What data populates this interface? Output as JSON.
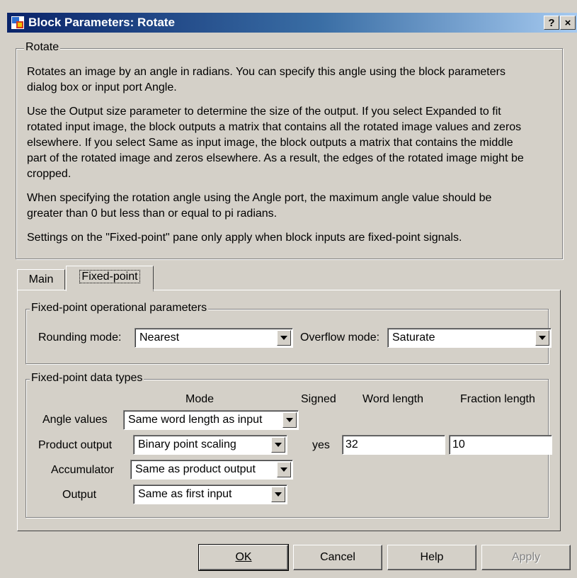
{
  "window": {
    "title": "Block Parameters: Rotate",
    "help_glyph": "?",
    "close_glyph": "×"
  },
  "description": {
    "group_title": "Rotate",
    "lines": [
      "Rotates an image by an angle in radians. You can specify this angle using the block parameters",
      "dialog box or input port Angle.",
      "Use the Output size parameter to determine the size of the output. If you select Expanded to fit",
      "rotated input image, the block outputs a matrix that contains all the rotated image values and zeros",
      "elsewhere. If you select Same as input image, the block outputs a matrix that contains the middle",
      "part of the rotated image and zeros elsewhere. As a result, the edges of the rotated image might be",
      "cropped.",
      "When specifying the rotation angle using the Angle port, the maximum angle value should be",
      "greater than 0 but less than or equal to pi radians.",
      "Settings on the \"Fixed-point\" pane only apply when block inputs are fixed-point signals."
    ]
  },
  "tabs": [
    {
      "label": "Main",
      "active": false
    },
    {
      "label": "Fixed-point",
      "active": true
    }
  ],
  "operational": {
    "group_title": "Fixed-point operational parameters",
    "rounding_label": "Rounding mode:",
    "rounding_value": "Nearest",
    "overflow_label": "Overflow mode:",
    "overflow_value": "Saturate"
  },
  "datatypes": {
    "group_title": "Fixed-point data types",
    "headers": {
      "mode": "Mode",
      "signed": "Signed",
      "word_length": "Word length",
      "fraction_length": "Fraction length"
    },
    "rows": [
      {
        "label": "Angle values",
        "mode": "Same word length as input"
      },
      {
        "label": "Product output",
        "mode": "Binary point scaling",
        "signed": "yes",
        "word_length": "32",
        "fraction_length": "10"
      },
      {
        "label": "Accumulator",
        "mode": "Same as product output"
      },
      {
        "label": "Output",
        "mode": "Same as first input"
      }
    ]
  },
  "buttons": {
    "ok": "OK",
    "cancel": "Cancel",
    "help": "Help",
    "apply": "Apply"
  },
  "colors": {
    "face": "#d4d0c8",
    "title_start": "#0a246a",
    "title_end": "#a6caf0",
    "disabled_text": "#808080"
  }
}
